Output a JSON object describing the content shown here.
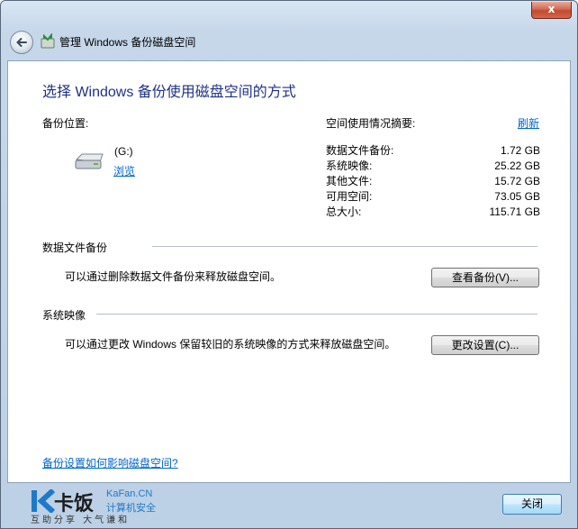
{
  "window": {
    "title": "管理 Windows 备份磁盘空间",
    "close_glyph": "x"
  },
  "main": {
    "heading": "选择 Windows 备份使用磁盘空间的方式",
    "backup_location_label": "备份位置:",
    "drive": {
      "name": "(G:)",
      "browse_link": "浏览"
    },
    "summary": {
      "label": "空间使用情况摘要:",
      "refresh_link": "刷新",
      "rows": [
        {
          "name": "数据文件备份:",
          "value": "1.72 GB"
        },
        {
          "name": "系统映像:",
          "value": "25.22 GB"
        },
        {
          "name": "其他文件:",
          "value": "15.72 GB"
        },
        {
          "name": "可用空间:",
          "value": "73.05 GB"
        },
        {
          "name": "总大小:",
          "value": "115.71 GB"
        }
      ]
    },
    "data_backup": {
      "title": "数据文件备份",
      "description": "可以通过删除数据文件备份来释放磁盘空间。",
      "button": "查看备份(V)..."
    },
    "system_image": {
      "title": "系统映像",
      "description": "可以通过更改 Windows 保留较旧的系统映像的方式来释放磁盘空间。",
      "button": "更改设置(C)..."
    },
    "help_link": "备份设置如何影响磁盘空间?"
  },
  "footer": {
    "logo": {
      "text": "卡饭",
      "slogan": "互助分享 大气谦和",
      "domain": "KaFan.CN",
      "sub": "计算机安全"
    },
    "close_button": "关闭"
  },
  "colors": {
    "heading": "#1e3287",
    "link": "#0066cc",
    "close_red": "#c04a31"
  }
}
